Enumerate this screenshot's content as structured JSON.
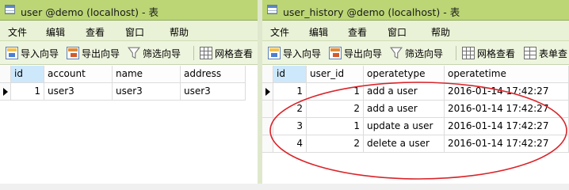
{
  "windows": {
    "left": {
      "title": "user @demo (localhost) - 表",
      "menu": [
        "文件",
        "编辑",
        "查看",
        "窗口",
        "帮助"
      ],
      "toolbar": {
        "import_label": "导入向导",
        "export_label": "导出向导",
        "filter_label": "筛选向导",
        "grid_label": "网格查看"
      },
      "columns": [
        "id",
        "account",
        "name",
        "address"
      ],
      "rows": [
        [
          "1",
          "user3",
          "user3",
          "user3"
        ]
      ]
    },
    "right": {
      "title": "user_history @demo (localhost) - 表",
      "menu": [
        "文件",
        "编辑",
        "查看",
        "窗口",
        "帮助"
      ],
      "toolbar": {
        "import_label": "导入向导",
        "export_label": "导出向导",
        "filter_label": "筛选向导",
        "grid_label": "网格查看",
        "table_label": "表单查"
      },
      "columns": [
        "id",
        "user_id",
        "operatetype",
        "operatetime"
      ],
      "rows": [
        [
          "1",
          "1",
          "add a user",
          "2016-01-14 17:42:27"
        ],
        [
          "2",
          "2",
          "add a user",
          "2016-01-14 17:42:27"
        ],
        [
          "3",
          "1",
          "update a user",
          "2016-01-14 17:42:27"
        ],
        [
          "4",
          "2",
          "delete a user",
          "2016-01-14 17:42:27"
        ]
      ]
    }
  },
  "colors": {
    "titlebar": "#bcd676",
    "selected_header": "#cde8fb",
    "annotation": "#d9252a"
  },
  "icons": {
    "window": "table-window-icon",
    "import": "import-wizard-icon",
    "export": "export-wizard-icon",
    "filter": "funnel-icon",
    "grid": "grid-view-icon",
    "form": "form-view-icon",
    "row_pointer": "current-row-arrow-icon"
  }
}
